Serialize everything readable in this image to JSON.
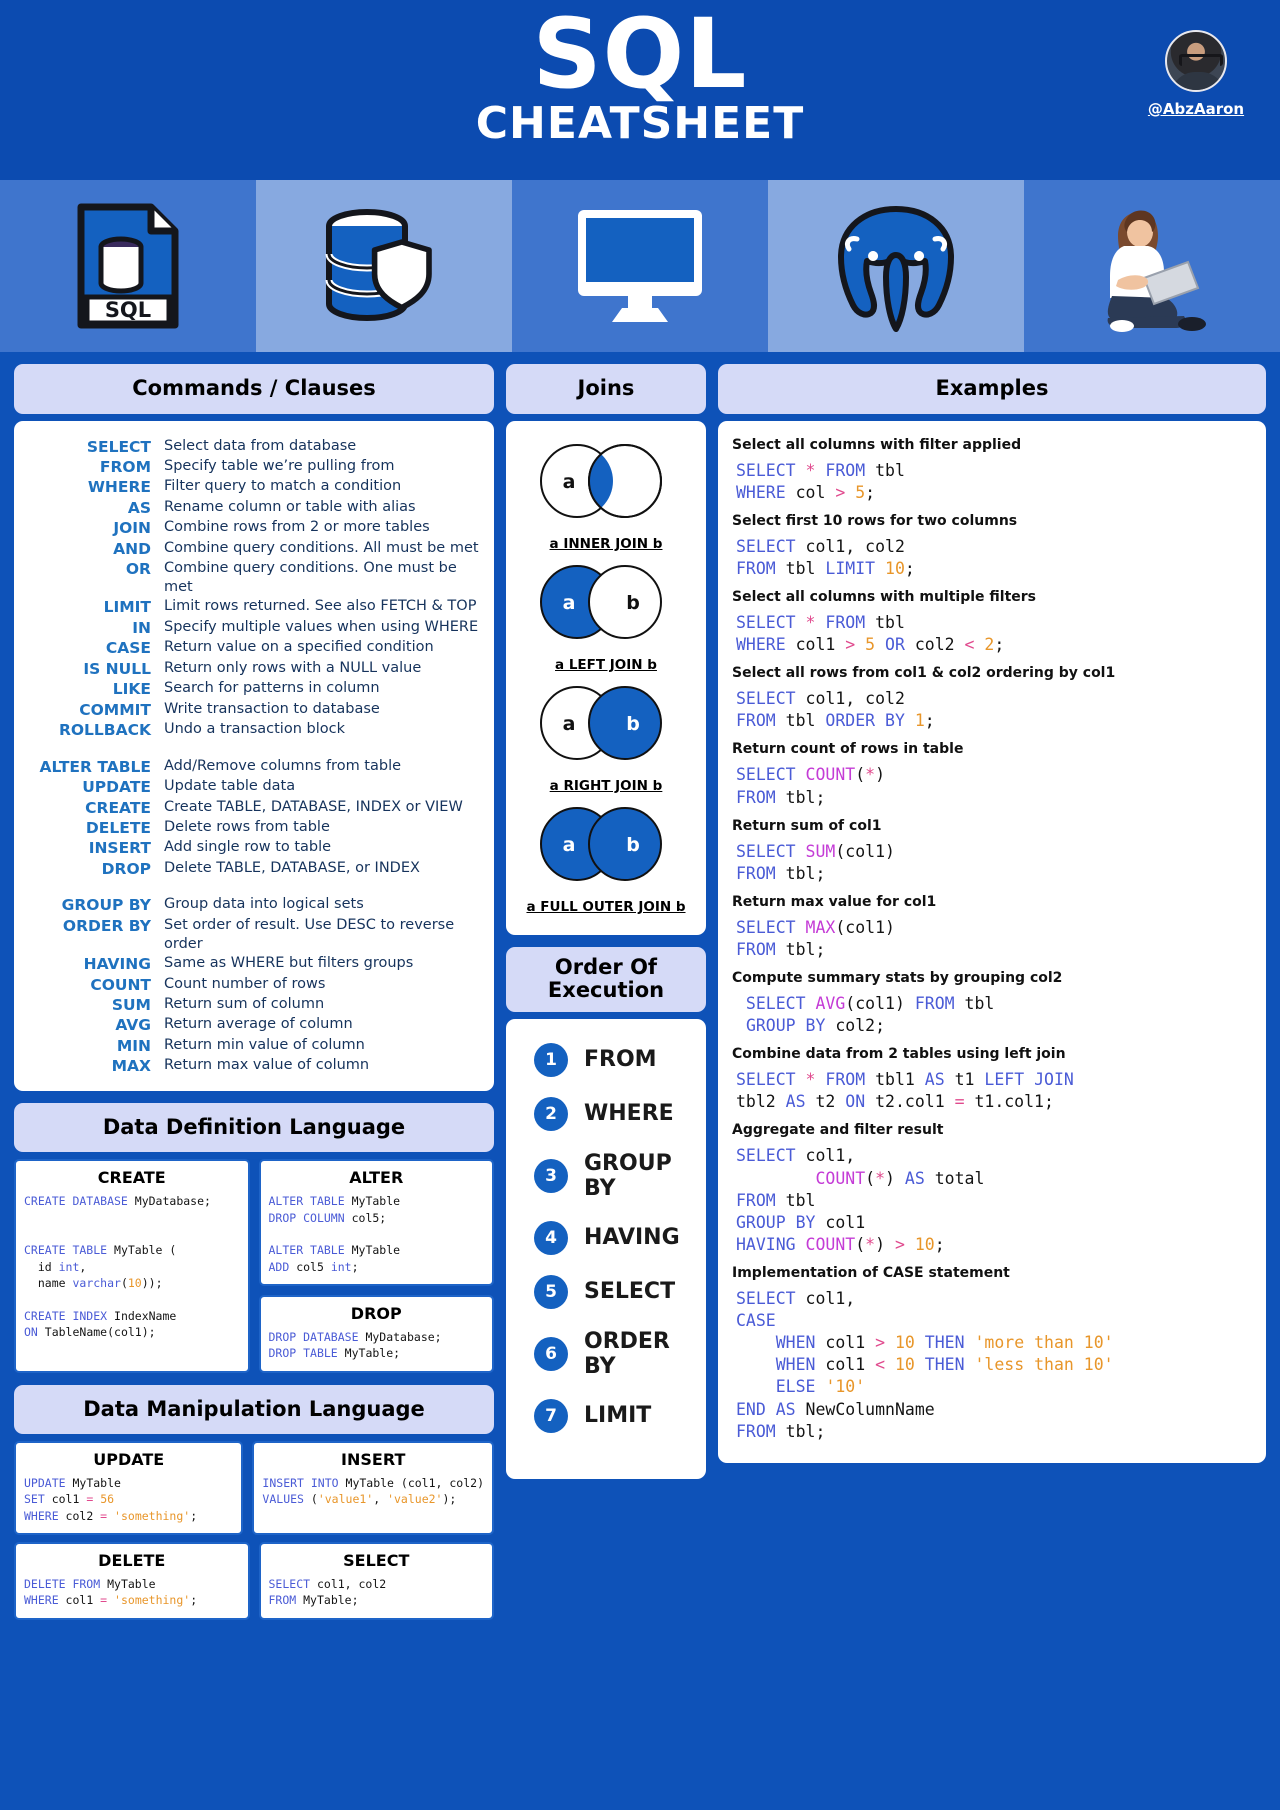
{
  "header": {
    "title_main": "SQL",
    "title_sub": "CHEATSHEET",
    "handle": "@AbzAaron",
    "avatar_name": "author-avatar"
  },
  "icon_strip": [
    {
      "name": "sql-file-icon",
      "label": "SQL"
    },
    {
      "name": "database-shield-icon",
      "label": ""
    },
    {
      "name": "monitor-icon",
      "label": ""
    },
    {
      "name": "postgresql-elephant-icon",
      "label": ""
    },
    {
      "name": "person-laptop-illustration",
      "label": ""
    }
  ],
  "commands": {
    "heading": "Commands / Clauses",
    "groups": [
      [
        {
          "key": "SELECT",
          "desc": "Select data from database"
        },
        {
          "key": "FROM",
          "desc": "Specify table we’re pulling from"
        },
        {
          "key": "WHERE",
          "desc": "Filter query to match a condition"
        },
        {
          "key": "AS",
          "desc": "Rename column or table with alias"
        },
        {
          "key": "JOIN",
          "desc": "Combine rows from 2 or more tables"
        },
        {
          "key": "AND",
          "desc": "Combine query conditions. All must be met"
        },
        {
          "key": "OR",
          "desc": "Combine query conditions. One must be met"
        },
        {
          "key": "LIMIT",
          "desc": "Limit rows returned. See also FETCH & TOP"
        },
        {
          "key": "IN",
          "desc": "Specify multiple values when using WHERE"
        },
        {
          "key": "CASE",
          "desc": "Return value on a specified condition"
        },
        {
          "key": "IS NULL",
          "desc": "Return only rows with a NULL value"
        },
        {
          "key": "LIKE",
          "desc": "Search for patterns in column"
        },
        {
          "key": "COMMIT",
          "desc": "Write transaction to database"
        },
        {
          "key": "ROLLBACK",
          "desc": "Undo a transaction block"
        }
      ],
      [
        {
          "key": "ALTER TABLE",
          "desc": "Add/Remove columns from table"
        },
        {
          "key": "UPDATE",
          "desc": "Update table data"
        },
        {
          "key": "CREATE",
          "desc": "Create TABLE, DATABASE, INDEX or VIEW"
        },
        {
          "key": "DELETE",
          "desc": "Delete rows from table"
        },
        {
          "key": "INSERT",
          "desc": "Add single row to table"
        },
        {
          "key": "DROP",
          "desc": "Delete TABLE, DATABASE, or INDEX"
        }
      ],
      [
        {
          "key": "GROUP BY",
          "desc": "Group data into logical sets"
        },
        {
          "key": "ORDER BY",
          "desc": "Set order of result. Use DESC to reverse order"
        },
        {
          "key": "HAVING",
          "desc": "Same as WHERE but filters groups"
        },
        {
          "key": "COUNT",
          "desc": "Count number of rows"
        },
        {
          "key": "SUM",
          "desc": "Return sum of column"
        },
        {
          "key": "AVG",
          "desc": "Return average of column"
        },
        {
          "key": "MIN",
          "desc": "Return min value of column"
        },
        {
          "key": "MAX",
          "desc": "Return max value of column"
        }
      ]
    ]
  },
  "joins": {
    "heading": "Joins",
    "left_label": "a",
    "right_label": "b",
    "items": [
      {
        "caption": "a INNER JOIN b",
        "fill": "intersection"
      },
      {
        "caption": "a LEFT JOIN b",
        "fill": "left"
      },
      {
        "caption": "a RIGHT JOIN b",
        "fill": "right"
      },
      {
        "caption": "a FULL OUTER JOIN b",
        "fill": "both"
      }
    ]
  },
  "order_of_execution": {
    "heading": "Order Of Execution",
    "steps": [
      {
        "num": "1",
        "label": "FROM"
      },
      {
        "num": "2",
        "label": "WHERE"
      },
      {
        "num": "3",
        "label": "GROUP BY"
      },
      {
        "num": "4",
        "label": "HAVING"
      },
      {
        "num": "5",
        "label": "SELECT"
      },
      {
        "num": "6",
        "label": "ORDER BY"
      },
      {
        "num": "7",
        "label": "LIMIT"
      }
    ]
  },
  "examples": {
    "heading": "Examples",
    "items": [
      {
        "title": "Select all columns with filter applied",
        "tokens": [
          [
            "kw",
            "SELECT"
          ],
          [
            "id",
            " "
          ],
          [
            "op",
            "*"
          ],
          [
            "id",
            " "
          ],
          [
            "kw",
            "FROM"
          ],
          [
            "id",
            " tbl\n"
          ],
          [
            "kw",
            "WHERE"
          ],
          [
            "id",
            " col "
          ],
          [
            "op",
            ">"
          ],
          [
            "id",
            " "
          ],
          [
            "num",
            "5"
          ],
          [
            "id",
            ";"
          ]
        ]
      },
      {
        "title": "Select first 10 rows for two columns",
        "tokens": [
          [
            "kw",
            "SELECT"
          ],
          [
            "id",
            " col1, col2\n"
          ],
          [
            "kw",
            "FROM"
          ],
          [
            "id",
            " tbl "
          ],
          [
            "kw",
            "LIMIT"
          ],
          [
            "id",
            " "
          ],
          [
            "num",
            "10"
          ],
          [
            "id",
            ";"
          ]
        ]
      },
      {
        "title": "Select all columns with multiple filters",
        "tokens": [
          [
            "kw",
            "SELECT"
          ],
          [
            "id",
            " "
          ],
          [
            "op",
            "*"
          ],
          [
            "id",
            " "
          ],
          [
            "kw",
            "FROM"
          ],
          [
            "id",
            " tbl\n"
          ],
          [
            "kw",
            "WHERE"
          ],
          [
            "id",
            " col1 "
          ],
          [
            "op",
            ">"
          ],
          [
            "id",
            " "
          ],
          [
            "num",
            "5"
          ],
          [
            "id",
            " "
          ],
          [
            "kw",
            "OR"
          ],
          [
            "id",
            " col2 "
          ],
          [
            "op",
            "<"
          ],
          [
            "id",
            " "
          ],
          [
            "num",
            "2"
          ],
          [
            "id",
            ";"
          ]
        ]
      },
      {
        "title": "Select all rows from col1 & col2 ordering by col1",
        "tokens": [
          [
            "kw",
            "SELECT"
          ],
          [
            "id",
            " col1, col2\n"
          ],
          [
            "kw",
            "FROM"
          ],
          [
            "id",
            " tbl "
          ],
          [
            "kw",
            "ORDER BY"
          ],
          [
            "id",
            " "
          ],
          [
            "num",
            "1"
          ],
          [
            "id",
            ";"
          ]
        ]
      },
      {
        "title": "Return count of rows in table",
        "tokens": [
          [
            "kw",
            "SELECT"
          ],
          [
            "id",
            " "
          ],
          [
            "fn",
            "COUNT"
          ],
          [
            "id",
            "("
          ],
          [
            "op",
            "*"
          ],
          [
            "id",
            ")\n"
          ],
          [
            "kw",
            "FROM"
          ],
          [
            "id",
            " tbl;"
          ]
        ]
      },
      {
        "title": "Return sum of col1",
        "tokens": [
          [
            "kw",
            "SELECT"
          ],
          [
            "id",
            " "
          ],
          [
            "fn",
            "SUM"
          ],
          [
            "id",
            "(col1)\n"
          ],
          [
            "kw",
            "FROM"
          ],
          [
            "id",
            " tbl;"
          ]
        ]
      },
      {
        "title": "Return max value for col1",
        "tokens": [
          [
            "kw",
            "SELECT"
          ],
          [
            "id",
            " "
          ],
          [
            "fn",
            "MAX"
          ],
          [
            "id",
            "(col1)\n"
          ],
          [
            "kw",
            "FROM"
          ],
          [
            "id",
            " tbl;"
          ]
        ]
      },
      {
        "title": "Compute summary stats by grouping col2",
        "tokens": [
          [
            "kw",
            " SELECT"
          ],
          [
            "id",
            " "
          ],
          [
            "fn",
            "AVG"
          ],
          [
            "id",
            "(col1) "
          ],
          [
            "kw",
            "FROM"
          ],
          [
            "id",
            " tbl\n "
          ],
          [
            "kw",
            "GROUP BY"
          ],
          [
            "id",
            " col2;"
          ]
        ]
      },
      {
        "title": "Combine data from 2 tables using left join",
        "tokens": [
          [
            "kw",
            "SELECT"
          ],
          [
            "id",
            " "
          ],
          [
            "op",
            "*"
          ],
          [
            "id",
            " "
          ],
          [
            "kw",
            "FROM"
          ],
          [
            "id",
            " tbl1 "
          ],
          [
            "kw",
            "AS"
          ],
          [
            "id",
            " t1 "
          ],
          [
            "kw",
            "LEFT JOIN"
          ],
          [
            "id",
            "\ntbl2 "
          ],
          [
            "kw",
            "AS"
          ],
          [
            "id",
            " t2 "
          ],
          [
            "kw",
            "ON"
          ],
          [
            "id",
            " t2.col1 "
          ],
          [
            "op",
            "="
          ],
          [
            "id",
            " t1.col1;"
          ]
        ]
      },
      {
        "title": "Aggregate and filter result",
        "tokens": [
          [
            "kw",
            "SELECT"
          ],
          [
            "id",
            " col1,\n        "
          ],
          [
            "fn",
            "COUNT"
          ],
          [
            "id",
            "("
          ],
          [
            "op",
            "*"
          ],
          [
            "id",
            ") "
          ],
          [
            "kw",
            "AS"
          ],
          [
            "id",
            " total\n"
          ],
          [
            "kw",
            "FROM"
          ],
          [
            "id",
            " tbl\n"
          ],
          [
            "kw",
            "GROUP BY"
          ],
          [
            "id",
            " col1\n"
          ],
          [
            "kw",
            "HAVING"
          ],
          [
            "id",
            " "
          ],
          [
            "fn",
            "COUNT"
          ],
          [
            "id",
            "("
          ],
          [
            "op",
            "*"
          ],
          [
            "id",
            ") "
          ],
          [
            "op",
            ">"
          ],
          [
            "id",
            " "
          ],
          [
            "num",
            "10"
          ],
          [
            "id",
            ";"
          ]
        ]
      },
      {
        "title": "Implementation of CASE statement",
        "tokens": [
          [
            "kw",
            "SELECT"
          ],
          [
            "id",
            " col1,\n"
          ],
          [
            "kw",
            "CASE"
          ],
          [
            "id",
            "\n    "
          ],
          [
            "kw",
            "WHEN"
          ],
          [
            "id",
            " col1 "
          ],
          [
            "op",
            ">"
          ],
          [
            "id",
            " "
          ],
          [
            "num",
            "10"
          ],
          [
            "id",
            " "
          ],
          [
            "kw",
            "THEN"
          ],
          [
            "id",
            " "
          ],
          [
            "str",
            "'more than 10'"
          ],
          [
            "id",
            "\n    "
          ],
          [
            "kw",
            "WHEN"
          ],
          [
            "id",
            " col1 "
          ],
          [
            "op",
            "<"
          ],
          [
            "id",
            " "
          ],
          [
            "num",
            "10"
          ],
          [
            "id",
            " "
          ],
          [
            "kw",
            "THEN"
          ],
          [
            "id",
            " "
          ],
          [
            "str",
            "'less than 10'"
          ],
          [
            "id",
            "\n    "
          ],
          [
            "kw",
            "ELSE"
          ],
          [
            "id",
            " "
          ],
          [
            "str",
            "'10'"
          ],
          [
            "id",
            "\n"
          ],
          [
            "kw",
            "END"
          ],
          [
            "id",
            " "
          ],
          [
            "kw",
            "AS"
          ],
          [
            "id",
            " NewColumnName\n"
          ],
          [
            "kw",
            "FROM"
          ],
          [
            "id",
            " tbl;"
          ]
        ]
      }
    ]
  },
  "ddl": {
    "heading": "Data Definition Language",
    "cards": [
      {
        "title": "CREATE",
        "tokens": [
          [
            "kw",
            "CREATE DATABASE"
          ],
          [
            "id",
            " MyDatabase;"
          ],
          [
            "id",
            "\n\n\n"
          ],
          [
            "kw",
            "CREATE TABLE"
          ],
          [
            "id",
            " MyTable (\n  id "
          ],
          [
            "kw",
            "int"
          ],
          [
            "id",
            ",\n  name "
          ],
          [
            "kw",
            "varchar"
          ],
          [
            "id",
            "("
          ],
          [
            "num",
            "10"
          ],
          [
            "id",
            "));"
          ],
          [
            "id",
            "\n\n"
          ],
          [
            "kw",
            "CREATE INDEX"
          ],
          [
            "id",
            " IndexName\n"
          ],
          [
            "kw",
            "ON"
          ],
          [
            "id",
            " TableName(col1);"
          ]
        ]
      },
      {
        "title": "ALTER",
        "tokens": [
          [
            "kw",
            "ALTER TABLE"
          ],
          [
            "id",
            " MyTable\n"
          ],
          [
            "kw",
            "DROP COLUMN"
          ],
          [
            "id",
            " col5;"
          ],
          [
            "id",
            "\n\n"
          ],
          [
            "kw",
            "ALTER TABLE"
          ],
          [
            "id",
            " MyTable\n"
          ],
          [
            "kw",
            "ADD"
          ],
          [
            "id",
            " col5 "
          ],
          [
            "kw",
            "int"
          ],
          [
            "id",
            ";"
          ]
        ]
      },
      {
        "title": "DROP",
        "tokens": [
          [
            "kw",
            "DROP DATABASE"
          ],
          [
            "id",
            " MyDatabase;\n"
          ],
          [
            "kw",
            "DROP TABLE"
          ],
          [
            "id",
            " MyTable;"
          ]
        ]
      }
    ]
  },
  "dml": {
    "heading": "Data Manipulation Language",
    "cards": [
      {
        "title": "UPDATE",
        "tokens": [
          [
            "kw",
            "UPDATE"
          ],
          [
            "id",
            " MyTable\n"
          ],
          [
            "kw",
            "SET"
          ],
          [
            "id",
            " col1 "
          ],
          [
            "op",
            "="
          ],
          [
            "id",
            " "
          ],
          [
            "num",
            "56"
          ],
          [
            "id",
            "\n"
          ],
          [
            "kw",
            "WHERE"
          ],
          [
            "id",
            " col2 "
          ],
          [
            "op",
            "="
          ],
          [
            "id",
            " "
          ],
          [
            "str",
            "'something'"
          ],
          [
            "id",
            ";"
          ]
        ]
      },
      {
        "title": "INSERT",
        "tokens": [
          [
            "kw",
            "INSERT INTO"
          ],
          [
            "id",
            " MyTable (col1, col2)\n"
          ],
          [
            "kw",
            "VALUES"
          ],
          [
            "id",
            " ("
          ],
          [
            "str",
            "'value1'"
          ],
          [
            "id",
            ", "
          ],
          [
            "str",
            "'value2'"
          ],
          [
            "id",
            ");"
          ]
        ]
      },
      {
        "title": "DELETE",
        "tokens": [
          [
            "kw",
            "DELETE FROM"
          ],
          [
            "id",
            " MyTable\n"
          ],
          [
            "kw",
            "WHERE"
          ],
          [
            "id",
            " col1 "
          ],
          [
            "op",
            "="
          ],
          [
            "id",
            " "
          ],
          [
            "str",
            "'something'"
          ],
          [
            "id",
            ";"
          ]
        ]
      },
      {
        "title": "SELECT",
        "tokens": [
          [
            "kw",
            "SELECT"
          ],
          [
            "id",
            " col1, col2\n"
          ],
          [
            "kw",
            "FROM"
          ],
          [
            "id",
            " MyTable;"
          ]
        ]
      }
    ]
  },
  "colors": {
    "page_bg": "#0e52b8",
    "header_bg": "#0c4bb0",
    "panel_head_bg": "#d5daf7",
    "accent_blue": "#1461c0",
    "key_blue": "#1f72bf",
    "venn_fill": "#1461c0"
  }
}
